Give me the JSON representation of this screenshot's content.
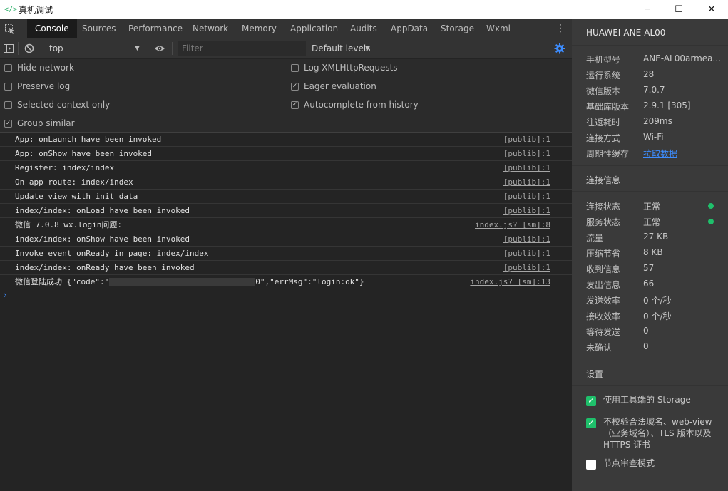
{
  "window": {
    "app_icon": "</>",
    "title": "真机调试",
    "minimize": "─",
    "maximize": "☐",
    "close": "✕"
  },
  "tabs": [
    "Console",
    "Sources",
    "Performance",
    "Network",
    "Memory",
    "Application",
    "Audits",
    "AppData",
    "Storage",
    "Wxml"
  ],
  "active_tab": "Console",
  "toolbar": {
    "context": "top",
    "filter_placeholder": "Filter",
    "levels": "Default levels",
    "more": "⋮",
    "arrow": "▼"
  },
  "settings": {
    "hide_network": "Hide network",
    "preserve_log": "Preserve log",
    "selected_context": "Selected context only",
    "group_similar": "Group similar",
    "log_xhr": "Log XMLHttpRequests",
    "eager_eval": "Eager evaluation",
    "autocomplete": "Autocomplete from history",
    "checked": {
      "hide_network": false,
      "preserve_log": false,
      "selected_context": false,
      "group_similar": true,
      "log_xhr": false,
      "eager_eval": true,
      "autocomplete": true
    }
  },
  "console": {
    "messages": [
      {
        "text": "App: onLaunch have been invoked",
        "source": "[publib]:1"
      },
      {
        "text": "App: onShow have been invoked",
        "source": "[publib]:1"
      },
      {
        "text": "Register: index/index",
        "source": "[publib]:1"
      },
      {
        "text": "On app route: index/index",
        "source": "[publib]:1"
      },
      {
        "text": "Update view with init data",
        "source": "[publib]:1"
      },
      {
        "text": "index/index: onLoad have been invoked",
        "source": "[publib]:1"
      },
      {
        "text": "微信 7.0.8 wx.login问题:",
        "source": "index.js? [sm]:8"
      },
      {
        "text": "index/index: onShow have been invoked",
        "source": "[publib]:1"
      },
      {
        "text": "Invoke event onReady in page: index/index",
        "source": "[publib]:1"
      },
      {
        "text": "index/index: onReady have been invoked",
        "source": "[publib]:1"
      }
    ],
    "last": {
      "prefix": "微信登陆成功 {\"code\":\"",
      "suffix": "0\",\"errMsg\":\"login:ok\"}",
      "source": "index.js? [sm]:13"
    },
    "prompt": "›"
  },
  "panel": {
    "device": "HUAWEI-ANE-AL00",
    "info": [
      {
        "k": "手机型号",
        "v": "ANE-AL00armea..."
      },
      {
        "k": "运行系统",
        "v": "28"
      },
      {
        "k": "微信版本",
        "v": "7.0.7"
      },
      {
        "k": "基础库版本",
        "v": "2.9.1 [305]"
      },
      {
        "k": "往返耗时",
        "v": "209ms"
      },
      {
        "k": "连接方式",
        "v": "Wi-Fi"
      },
      {
        "k": "周期性缓存",
        "v": "拉取数据"
      }
    ],
    "conn_title": "连接信息",
    "conn": [
      {
        "k": "连接状态",
        "v": "正常"
      },
      {
        "k": "服务状态",
        "v": "正常"
      },
      {
        "k": "流量",
        "v": "27 KB"
      },
      {
        "k": "压缩节省",
        "v": "8 KB"
      },
      {
        "k": "收到信息",
        "v": "57"
      },
      {
        "k": "发出信息",
        "v": "66"
      },
      {
        "k": "发送效率",
        "v": "0 个/秒"
      },
      {
        "k": "接收效率",
        "v": "0 个/秒"
      },
      {
        "k": "等待发送",
        "v": "0"
      },
      {
        "k": "未确认",
        "v": "0"
      }
    ],
    "settings_title": "设置",
    "settings": [
      {
        "label": "使用工具端的 Storage",
        "checked": true
      },
      {
        "label": "不校验合法域名、web-view（业务域名）、TLS 版本以及 HTTPS 证书",
        "checked": true
      },
      {
        "label": "节点审查模式",
        "checked": false
      }
    ],
    "status_color": "#1fc06b",
    "link_color": "#3d8dff"
  }
}
